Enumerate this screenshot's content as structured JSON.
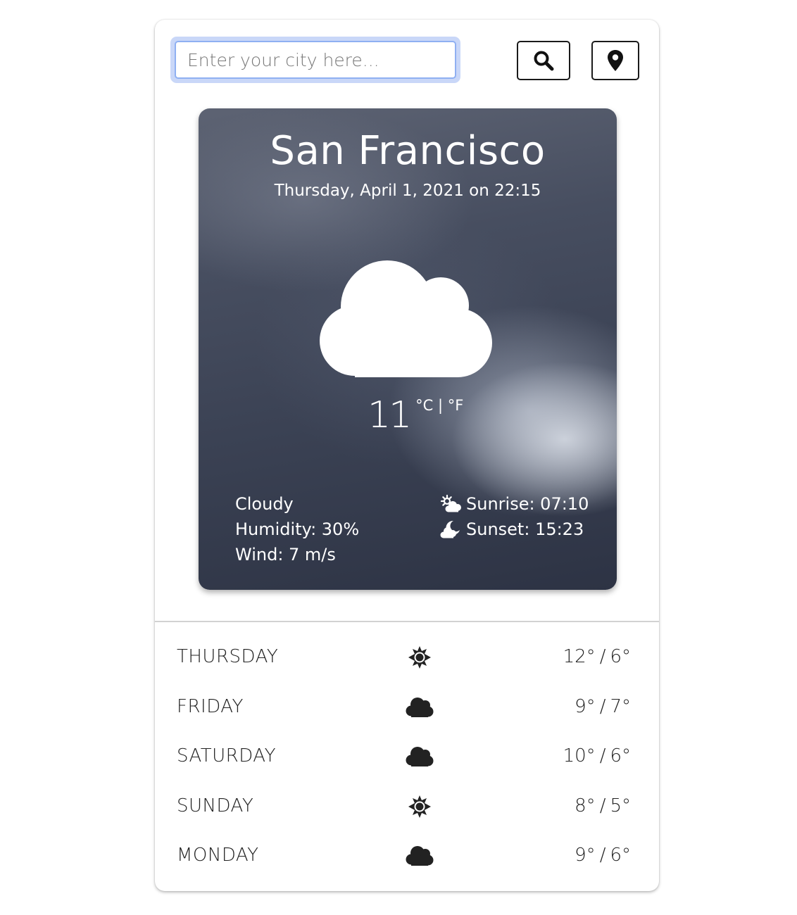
{
  "search": {
    "placeholder": "Enter your city here..."
  },
  "toolbar": {
    "search_icon": "search-icon",
    "location_icon": "map-pin-icon"
  },
  "current": {
    "city": "San Francisco",
    "datetime": "Thursday, April 1, 2021 on 22:15",
    "icon": "cloud-icon",
    "temperature": "11",
    "unit_celsius": "°C",
    "unit_separator": "|",
    "unit_fahrenheit": "°F",
    "description": "Cloudy",
    "humidity": "Humidity: 30%",
    "wind": "Wind: 7 m/s",
    "sunrise": "Sunrise: 07:10",
    "sunset": "Sunset: 15:23",
    "sunrise_icon": "sun-cloud-icon",
    "sunset_icon": "moon-cloud-icon"
  },
  "forecast": [
    {
      "day": "THURSDAY",
      "icon": "sun-icon",
      "high": "12°",
      "sep": "/",
      "low": "6°"
    },
    {
      "day": "FRIDAY",
      "icon": "cloud-icon",
      "high": "9°",
      "sep": "/",
      "low": "7°"
    },
    {
      "day": "SATURDAY",
      "icon": "cloud-icon",
      "high": "10°",
      "sep": "/",
      "low": "6°"
    },
    {
      "day": "SUNDAY",
      "icon": "sun-icon",
      "high": "8°",
      "sep": "/",
      "low": "5°"
    },
    {
      "day": "MONDAY",
      "icon": "cloud-icon",
      "high": "9°",
      "sep": "/",
      "low": "6°"
    }
  ],
  "colors": {
    "card_dark": "#2d3344",
    "text_dark": "#222222",
    "focus_ring": "#c9d7f8"
  }
}
